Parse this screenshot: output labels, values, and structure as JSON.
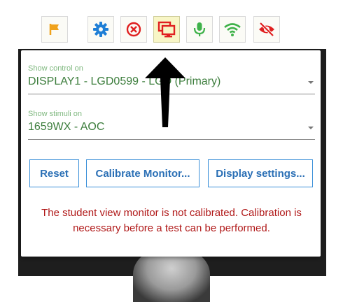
{
  "toolbar": {
    "buttons": [
      {
        "icon": "flag-icon",
        "color": "#f0a21c",
        "active": false
      },
      {
        "icon": "gear-icon",
        "color": "#1f7fd6",
        "active": false
      },
      {
        "icon": "cancel-circle-icon",
        "color": "#e02020",
        "active": false
      },
      {
        "icon": "monitors-icon",
        "color": "#e02020",
        "active": true
      },
      {
        "icon": "microphone-icon",
        "color": "#3fb24a",
        "active": false
      },
      {
        "icon": "wifi-icon",
        "color": "#3fb24a",
        "active": false
      },
      {
        "icon": "eye-off-icon",
        "color": "#e02020",
        "active": false
      }
    ]
  },
  "panel": {
    "control": {
      "label": "Show control on",
      "value": "DISPLAY1 - LGD0599 - LGD (Primary)"
    },
    "stimuli": {
      "label": "Show stimuli on",
      "value": "1659WX - AOC"
    },
    "buttons": {
      "reset": "Reset",
      "calibrate": "Calibrate Monitor...",
      "display_settings": "Display settings..."
    },
    "message": "The student view monitor is not calibrated. Calibration is necessary before a test can be performed."
  },
  "colors": {
    "label_green": "#7fb87f",
    "value_green": "#3c7d3c",
    "button_blue": "#2a6fb5",
    "error_red": "#b01818"
  }
}
